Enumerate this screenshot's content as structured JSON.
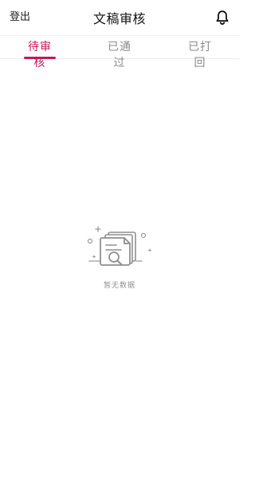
{
  "header": {
    "logout_label": "登出",
    "title": "文稿审核",
    "bell_icon": "bell-icon"
  },
  "tabs": [
    {
      "label": "待审核",
      "active": true
    },
    {
      "label": "已通过",
      "active": false
    },
    {
      "label": "已打回",
      "active": false
    }
  ],
  "empty_state": {
    "illustration_icon": "document-search-icon",
    "text": "暂无数据"
  },
  "colors": {
    "accent": "#c2185b",
    "tab_inactive": "#8c8c8c",
    "divider": "#ececec",
    "illustration_stroke": "#8f8f8f"
  }
}
